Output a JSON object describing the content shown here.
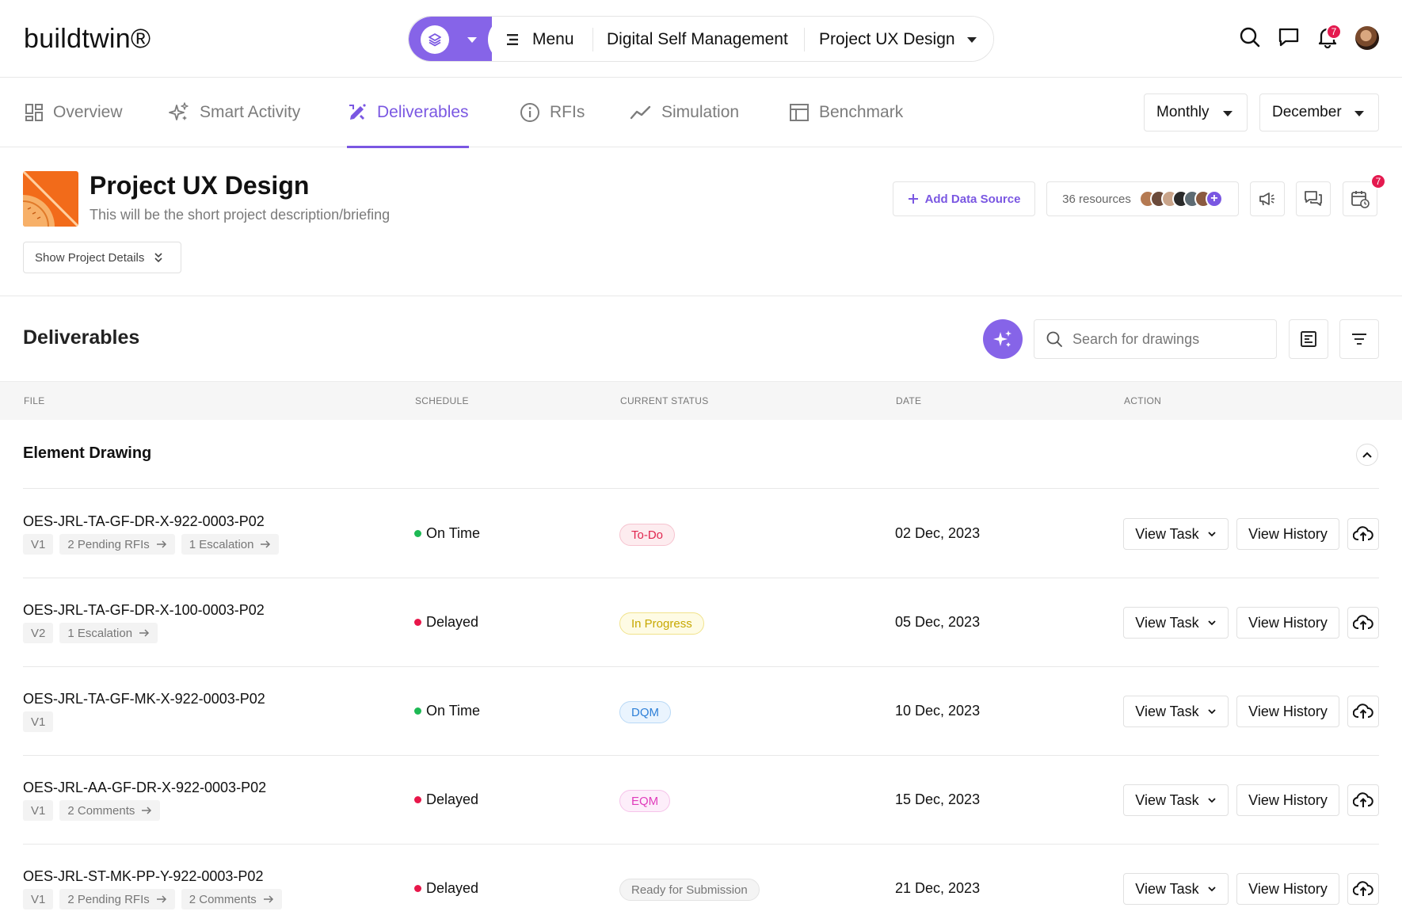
{
  "app": {
    "logo": "buildtwin®",
    "nav": {
      "menu_label": "Menu",
      "module": "Digital Self Management",
      "project": "Project UX Design"
    },
    "notifications_count": "7",
    "accent_color": "#7a57e2"
  },
  "tabs": [
    {
      "label": "Overview",
      "icon": "grid-icon"
    },
    {
      "label": "Smart Activity",
      "icon": "sparkle-icon"
    },
    {
      "label": "Deliverables",
      "icon": "pencil-ruler-icon",
      "active": true
    },
    {
      "label": "RFIs",
      "icon": "info-circle-icon"
    },
    {
      "label": "Simulation",
      "icon": "trend-line-icon"
    },
    {
      "label": "Benchmark",
      "icon": "table-icon"
    }
  ],
  "filters": {
    "period": "Monthly",
    "month": "December"
  },
  "project": {
    "title": "Project UX Design",
    "description": "This will be the short project description/briefing",
    "show_details_label": "Show Project Details",
    "add_data_source_label": "Add Data Source",
    "resources_label": "36 resources",
    "calendar_badge": "7"
  },
  "deliverables": {
    "title": "Deliverables",
    "search_placeholder": "Search for drawings",
    "columns": {
      "file": "FILE",
      "schedule": "SCHEDULE",
      "status": "CURRENT STATUS",
      "date": "DATE",
      "action": "ACTION"
    },
    "group_title": "Element Drawing",
    "view_task_label": "View Task",
    "view_history_label": "View History",
    "rows": [
      {
        "file": "OES-JRL-TA-GF-DR-X-922-0003-P02",
        "chips": [
          "V1",
          "2 Pending RFIs",
          "1 Escalation"
        ],
        "schedule": "On Time",
        "status": "To-Do",
        "date": "02 Dec, 2023"
      },
      {
        "file": "OES-JRL-TA-GF-DR-X-100-0003-P02",
        "chips": [
          "V2",
          "1 Escalation"
        ],
        "schedule": "Delayed",
        "status": "In Progress",
        "date": "05 Dec, 2023"
      },
      {
        "file": "OES-JRL-TA-GF-MK-X-922-0003-P02",
        "chips": [
          "V1"
        ],
        "schedule": "On Time",
        "status": "DQM",
        "date": "10 Dec, 2023"
      },
      {
        "file": "OES-JRL-AA-GF-DR-X-922-0003-P02",
        "chips": [
          "V1",
          "2 Comments"
        ],
        "schedule": "Delayed",
        "status": "EQM",
        "date": "15 Dec, 2023"
      },
      {
        "file": "OES-JRL-ST-MK-PP-Y-922-0003-P02",
        "chips": [
          "V1",
          "2 Pending RFIs",
          "2 Comments"
        ],
        "schedule": "Delayed",
        "status": "Ready for Submission",
        "date": "21 Dec, 2023"
      }
    ]
  },
  "colors": {
    "on_time": "#1db954",
    "delayed": "#e8174a",
    "todo_bg": "#fdecef",
    "todo_fg": "#e0264f",
    "todo_border": "#f6c3cf",
    "progress_bg": "#fefbe4",
    "progress_fg": "#c7a800",
    "progress_border": "#f1e38c",
    "dqm_bg": "#eaf4fe",
    "dqm_fg": "#2f80d8",
    "dqm_border": "#b9d9f6",
    "eqm_bg": "#fdeefa",
    "eqm_fg": "#e03cbb",
    "eqm_border": "#f6c3ea",
    "ready_bg": "#f4f4f4",
    "ready_fg": "#777777",
    "ready_border": "#e3e3e3"
  }
}
